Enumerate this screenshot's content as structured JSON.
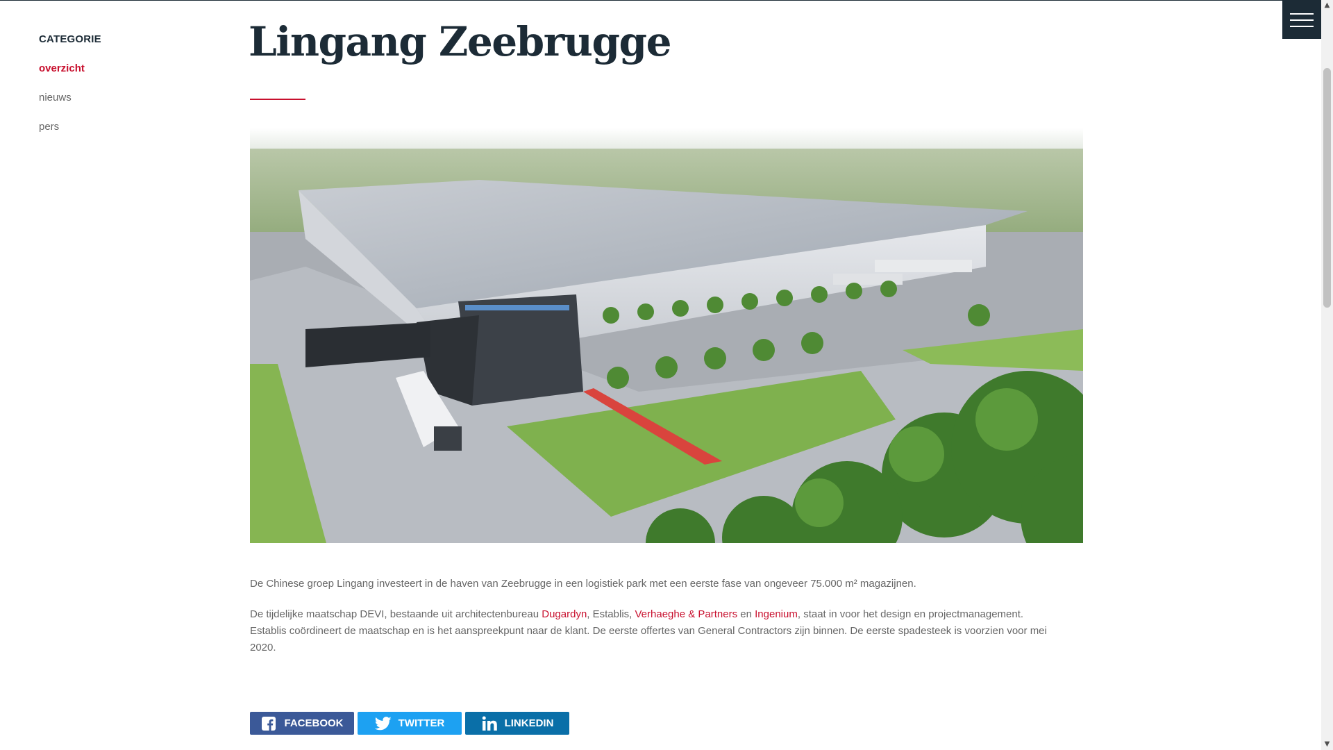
{
  "sidebar": {
    "heading": "CATEGORIE",
    "items": [
      {
        "label": "overzicht",
        "active": true
      },
      {
        "label": "nieuws",
        "active": false
      },
      {
        "label": "pers",
        "active": false
      }
    ]
  },
  "header": {
    "menu_icon": "hamburger-menu-icon"
  },
  "article": {
    "title": "Lingang Zeebrugge",
    "image_alt": "Lingang Zeebrugge",
    "p1": "De Chinese groep Lingang investeert in de haven van Zeebrugge in een logistiek park met een eerste fase van ongeveer 75.000 m² magazijnen.",
    "p2_a": "De tijdelijke maatschap DEVI, bestaande uit architectenbureau ",
    "link_dugardyn": "Dugardyn",
    "p2_b": ", Establis, ",
    "link_verhaeghe": "Verhaeghe & Partners",
    "p2_c": " en ",
    "link_ingenium": "Ingenium",
    "p2_d": ", staat in voor het design en projectmanagement. Establis coördineert de maatschap en is het aanspreekpunt naar de klant. De eerste offertes van General Contractors zijn binnen. De eerste spadesteek is voorzien voor mei 2020."
  },
  "share": {
    "facebook": "FACEBOOK",
    "twitter": "TWITTER",
    "linkedin": "LINKEDIN"
  },
  "colors": {
    "accent": "#c8102e",
    "navy": "#1c2b36",
    "facebook": "#3b5998",
    "twitter": "#1da1f2",
    "linkedin": "#0a6fa8"
  }
}
